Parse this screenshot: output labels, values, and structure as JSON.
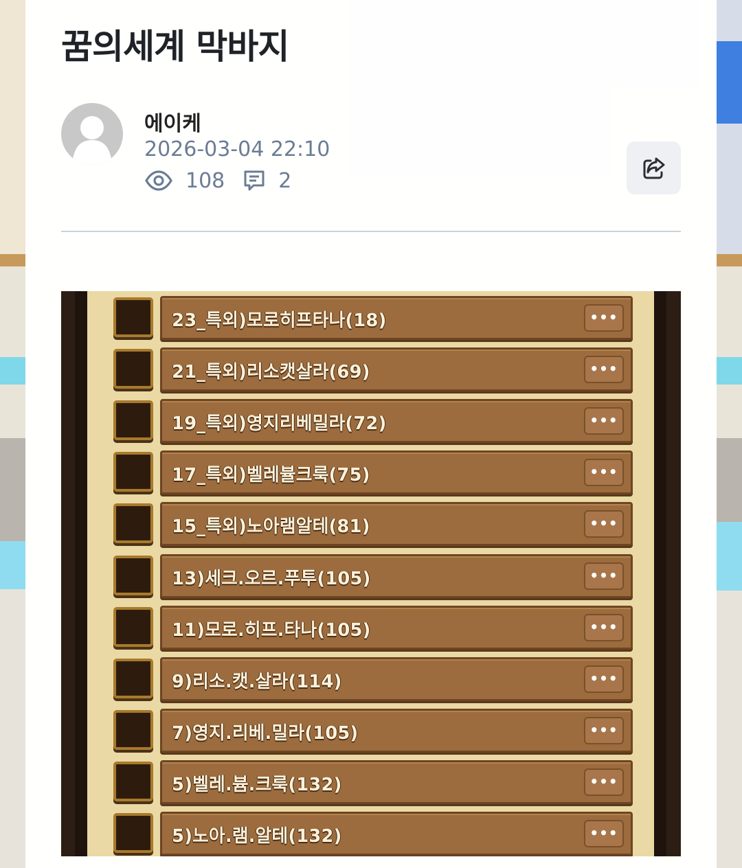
{
  "post": {
    "title": "꿈의세계 막바지",
    "author": "에이케",
    "datetime": "2026-03-04 22:10",
    "views": "108",
    "comments": "2"
  },
  "icons": {
    "views": "eye-icon",
    "comments": "comment-icon",
    "share": "share-icon",
    "avatar": "user-silhouette-icon"
  },
  "colors": {
    "title": "#1f2328",
    "meta": "#6b7c93",
    "share_bg": "#eef0f4",
    "row_bar": "#9c6c3e",
    "row_text": "#fbf1db"
  },
  "screenshot": {
    "rows": [
      {
        "label": "23_특외)모로히프타나(18)",
        "more": "•••"
      },
      {
        "label": "21_특외)리소캣살라(69)",
        "more": "•••"
      },
      {
        "label": "19_특외)영지리베밀라(72)",
        "more": "•••"
      },
      {
        "label": "17_특외)벨레뷸크룩(75)",
        "more": "•••"
      },
      {
        "label": "15_특외)노아램알테(81)",
        "more": "•••"
      },
      {
        "label": "13)세크.오르.푸투(105)",
        "more": "•••"
      },
      {
        "label": "11)모로.히프.타나(105)",
        "more": "•••"
      },
      {
        "label": "9)리소.캣.살라(114)",
        "more": "•••"
      },
      {
        "label": "7)영지.리베.밀라(105)",
        "more": "•••"
      },
      {
        "label": "5)벨레.븀.크룩(132)",
        "more": "•••"
      },
      {
        "label": "5)노아.램.알테(132)",
        "more": "•••"
      }
    ]
  }
}
